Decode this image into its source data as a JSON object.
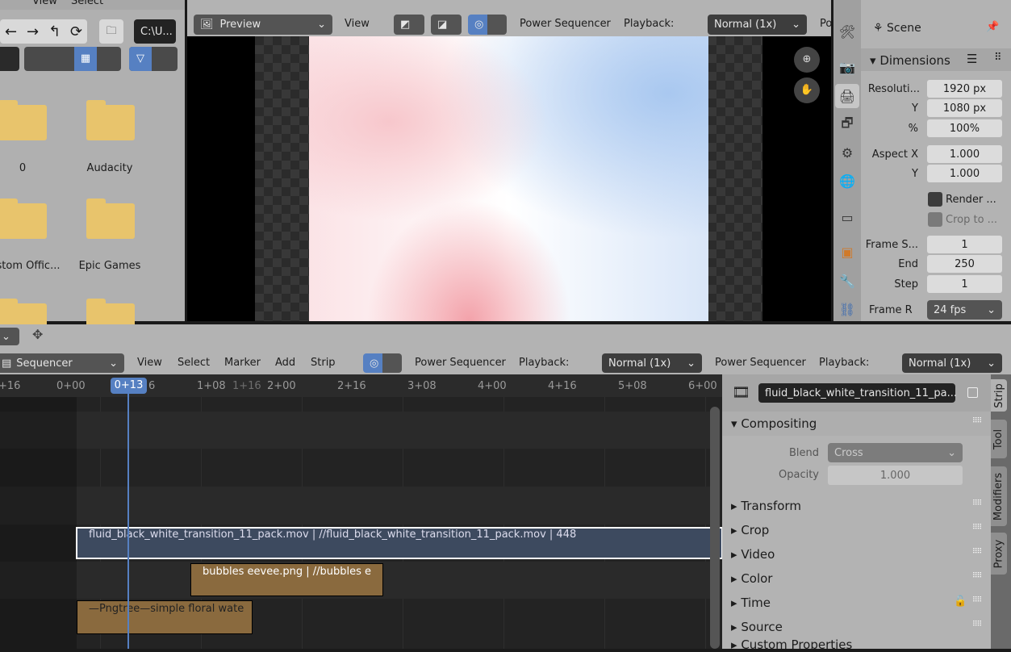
{
  "file_browser": {
    "menu": [
      "View",
      "Select"
    ],
    "path": "C:\\U...",
    "folders": [
      {
        "name": "0"
      },
      {
        "name": "Audacity"
      },
      {
        "name": "stom Offic..."
      },
      {
        "name": "Epic Games"
      }
    ]
  },
  "preview": {
    "mode": "Preview",
    "view_menu": "View",
    "power_sequencer": "Power Sequencer",
    "playback_label": "Playback:",
    "playback_value": "Normal (1x)",
    "cut": "Po"
  },
  "properties": {
    "scene": "Scene",
    "panel": "Dimensions",
    "fields": [
      {
        "label": "Resoluti...",
        "value": "1920 px"
      },
      {
        "label": "Y",
        "value": "1080 px"
      },
      {
        "label": "%",
        "value": "100%"
      },
      {
        "label": "Aspect X",
        "value": "1.000"
      },
      {
        "label": "Y",
        "value": "1.000"
      },
      {
        "label": "Frame S...",
        "value": "1"
      },
      {
        "label": "End",
        "value": "250"
      },
      {
        "label": "Step",
        "value": "1"
      }
    ],
    "render_region": "Render ...",
    "crop": "Crop to ...",
    "frame_rate_label": "Frame R",
    "frame_rate": "24 fps"
  },
  "sequencer": {
    "editor": "Sequencer",
    "menu": [
      "View",
      "Select",
      "Marker",
      "Add",
      "Strip"
    ],
    "power_sequencer": "Power Sequencer",
    "playback_label": "Playback:",
    "playback_value": "Normal (1x)",
    "power_sequencer2": "Power Sequencer",
    "playback_label2": "Playback:",
    "playback_value2": "Normal (1x)",
    "current_frame": "0+13",
    "ticks": [
      "+16",
      "0+00",
      "6",
      "1+08",
      "1+16",
      "2+00",
      "2+16",
      "3+08",
      "4+00",
      "4+16",
      "5+08",
      "6+00"
    ],
    "strips": [
      {
        "label": "fluid_black_white_transition_11_pack.mov | //fluid_black_white_transition_11_pack.mov | 448",
        "color": "#3d4a5f"
      },
      {
        "label": "bubbles eevee.png | //bubbles e",
        "color": "#8a6a3e"
      },
      {
        "label": "—Pngtree—simple floral wate",
        "color": "#8a6a3e"
      }
    ]
  },
  "sidebar": {
    "strip_name": "fluid_black_white_transition_11_pa...",
    "compositing": "Compositing",
    "blend_label": "Blend",
    "blend_value": "Cross",
    "opacity_label": "Opacity",
    "opacity_value": "1.000",
    "sections": [
      "Transform",
      "Crop",
      "Video",
      "Color",
      "Time",
      "Source",
      "Custom Properties"
    ],
    "tabs": [
      "Strip",
      "Tool",
      "Modifiers",
      "Proxy"
    ]
  }
}
